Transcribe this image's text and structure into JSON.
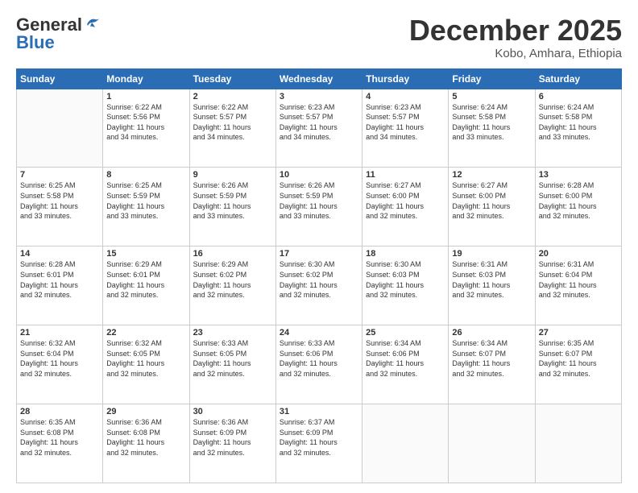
{
  "header": {
    "logo_line1": "General",
    "logo_line2": "Blue",
    "month": "December 2025",
    "location": "Kobo, Amhara, Ethiopia"
  },
  "weekdays": [
    "Sunday",
    "Monday",
    "Tuesday",
    "Wednesday",
    "Thursday",
    "Friday",
    "Saturday"
  ],
  "weeks": [
    [
      {
        "day": "",
        "info": ""
      },
      {
        "day": "1",
        "info": "Sunrise: 6:22 AM\nSunset: 5:56 PM\nDaylight: 11 hours\nand 34 minutes."
      },
      {
        "day": "2",
        "info": "Sunrise: 6:22 AM\nSunset: 5:57 PM\nDaylight: 11 hours\nand 34 minutes."
      },
      {
        "day": "3",
        "info": "Sunrise: 6:23 AM\nSunset: 5:57 PM\nDaylight: 11 hours\nand 34 minutes."
      },
      {
        "day": "4",
        "info": "Sunrise: 6:23 AM\nSunset: 5:57 PM\nDaylight: 11 hours\nand 34 minutes."
      },
      {
        "day": "5",
        "info": "Sunrise: 6:24 AM\nSunset: 5:58 PM\nDaylight: 11 hours\nand 33 minutes."
      },
      {
        "day": "6",
        "info": "Sunrise: 6:24 AM\nSunset: 5:58 PM\nDaylight: 11 hours\nand 33 minutes."
      }
    ],
    [
      {
        "day": "7",
        "info": "Sunrise: 6:25 AM\nSunset: 5:58 PM\nDaylight: 11 hours\nand 33 minutes."
      },
      {
        "day": "8",
        "info": "Sunrise: 6:25 AM\nSunset: 5:59 PM\nDaylight: 11 hours\nand 33 minutes."
      },
      {
        "day": "9",
        "info": "Sunrise: 6:26 AM\nSunset: 5:59 PM\nDaylight: 11 hours\nand 33 minutes."
      },
      {
        "day": "10",
        "info": "Sunrise: 6:26 AM\nSunset: 5:59 PM\nDaylight: 11 hours\nand 33 minutes."
      },
      {
        "day": "11",
        "info": "Sunrise: 6:27 AM\nSunset: 6:00 PM\nDaylight: 11 hours\nand 32 minutes."
      },
      {
        "day": "12",
        "info": "Sunrise: 6:27 AM\nSunset: 6:00 PM\nDaylight: 11 hours\nand 32 minutes."
      },
      {
        "day": "13",
        "info": "Sunrise: 6:28 AM\nSunset: 6:00 PM\nDaylight: 11 hours\nand 32 minutes."
      }
    ],
    [
      {
        "day": "14",
        "info": "Sunrise: 6:28 AM\nSunset: 6:01 PM\nDaylight: 11 hours\nand 32 minutes."
      },
      {
        "day": "15",
        "info": "Sunrise: 6:29 AM\nSunset: 6:01 PM\nDaylight: 11 hours\nand 32 minutes."
      },
      {
        "day": "16",
        "info": "Sunrise: 6:29 AM\nSunset: 6:02 PM\nDaylight: 11 hours\nand 32 minutes."
      },
      {
        "day": "17",
        "info": "Sunrise: 6:30 AM\nSunset: 6:02 PM\nDaylight: 11 hours\nand 32 minutes."
      },
      {
        "day": "18",
        "info": "Sunrise: 6:30 AM\nSunset: 6:03 PM\nDaylight: 11 hours\nand 32 minutes."
      },
      {
        "day": "19",
        "info": "Sunrise: 6:31 AM\nSunset: 6:03 PM\nDaylight: 11 hours\nand 32 minutes."
      },
      {
        "day": "20",
        "info": "Sunrise: 6:31 AM\nSunset: 6:04 PM\nDaylight: 11 hours\nand 32 minutes."
      }
    ],
    [
      {
        "day": "21",
        "info": "Sunrise: 6:32 AM\nSunset: 6:04 PM\nDaylight: 11 hours\nand 32 minutes."
      },
      {
        "day": "22",
        "info": "Sunrise: 6:32 AM\nSunset: 6:05 PM\nDaylight: 11 hours\nand 32 minutes."
      },
      {
        "day": "23",
        "info": "Sunrise: 6:33 AM\nSunset: 6:05 PM\nDaylight: 11 hours\nand 32 minutes."
      },
      {
        "day": "24",
        "info": "Sunrise: 6:33 AM\nSunset: 6:06 PM\nDaylight: 11 hours\nand 32 minutes."
      },
      {
        "day": "25",
        "info": "Sunrise: 6:34 AM\nSunset: 6:06 PM\nDaylight: 11 hours\nand 32 minutes."
      },
      {
        "day": "26",
        "info": "Sunrise: 6:34 AM\nSunset: 6:07 PM\nDaylight: 11 hours\nand 32 minutes."
      },
      {
        "day": "27",
        "info": "Sunrise: 6:35 AM\nSunset: 6:07 PM\nDaylight: 11 hours\nand 32 minutes."
      }
    ],
    [
      {
        "day": "28",
        "info": "Sunrise: 6:35 AM\nSunset: 6:08 PM\nDaylight: 11 hours\nand 32 minutes."
      },
      {
        "day": "29",
        "info": "Sunrise: 6:36 AM\nSunset: 6:08 PM\nDaylight: 11 hours\nand 32 minutes."
      },
      {
        "day": "30",
        "info": "Sunrise: 6:36 AM\nSunset: 6:09 PM\nDaylight: 11 hours\nand 32 minutes."
      },
      {
        "day": "31",
        "info": "Sunrise: 6:37 AM\nSunset: 6:09 PM\nDaylight: 11 hours\nand 32 minutes."
      },
      {
        "day": "",
        "info": ""
      },
      {
        "day": "",
        "info": ""
      },
      {
        "day": "",
        "info": ""
      }
    ]
  ]
}
